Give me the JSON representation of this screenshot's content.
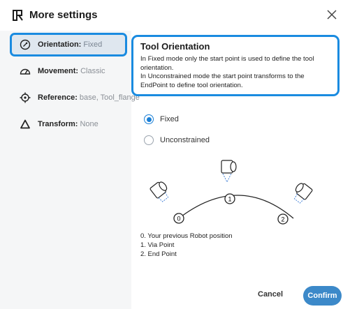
{
  "dialog": {
    "title": "More settings",
    "close_icon": "close-icon",
    "logo_icon": "robot-logo-icon"
  },
  "sidebar": {
    "items": [
      {
        "label": "Orientation:",
        "value": "Fixed",
        "icon": "orientation-icon",
        "active": true
      },
      {
        "label": "Movement:",
        "value": "Classic",
        "icon": "movement-icon",
        "active": false
      },
      {
        "label": "Reference:",
        "value": "base, Tool_flange",
        "icon": "reference-icon",
        "active": false
      },
      {
        "label": "Transform:",
        "value": "None",
        "icon": "transform-icon",
        "active": false
      }
    ]
  },
  "info": {
    "title": "Tool Orientation",
    "line1": "In Fixed mode only the start point is used to define the tool orientation.",
    "line2": "In Unconstrained mode the start point transforms to the EndPoint to define tool orientation."
  },
  "options": {
    "fixed": "Fixed",
    "unconstrained": "Unconstrained",
    "selected": "Fixed"
  },
  "diagram": {
    "points": [
      "0",
      "1",
      "2"
    ]
  },
  "legend": {
    "l0": "0. Your previous Robot position",
    "l1": "1. Via Point",
    "l2": "2. End Point"
  },
  "footer": {
    "cancel": "Cancel",
    "confirm": "Confirm"
  },
  "colors": {
    "accent": "#1a8be0",
    "confirm": "#3c89c9",
    "sidebar_bg": "#f5f6f7"
  }
}
